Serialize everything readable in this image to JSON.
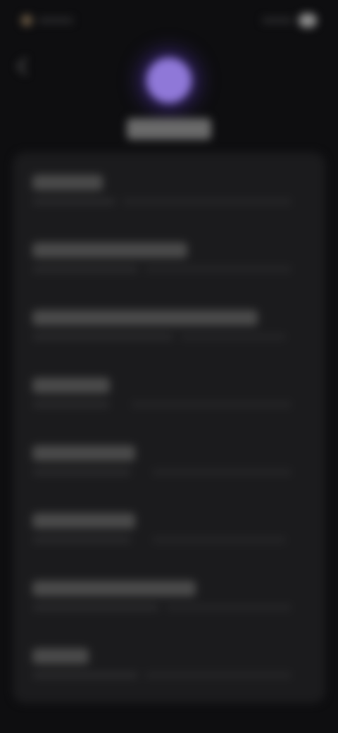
{
  "colors": {
    "background": "#0e0e10",
    "panel": "#1b1b1d",
    "avatar": "#8f78d8",
    "avatar_glow": "#462d96",
    "text_block": "#4a4a4a",
    "subtext_block": "#2c2c2e"
  },
  "status_bar": {
    "time": "",
    "icons": [
      "signal-icon",
      "battery-icon"
    ]
  },
  "header": {
    "back_icon": "chevron-left-icon",
    "profile_name": ""
  },
  "settings": {
    "items": [
      {
        "title": "",
        "subtitle": ""
      },
      {
        "title": "",
        "subtitle": ""
      },
      {
        "title": "",
        "subtitle": ""
      },
      {
        "title": "",
        "subtitle": ""
      },
      {
        "title": "",
        "subtitle": ""
      },
      {
        "title": "",
        "subtitle": ""
      },
      {
        "title": "",
        "subtitle": ""
      },
      {
        "title": "",
        "subtitle": ""
      }
    ]
  }
}
